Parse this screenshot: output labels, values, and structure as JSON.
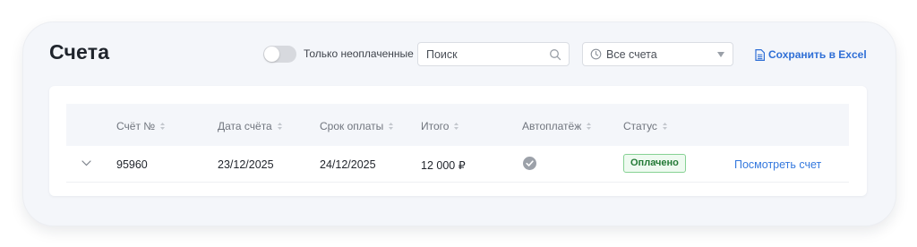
{
  "page": {
    "title": "Счета"
  },
  "toolbar": {
    "unpaid_toggle_label": "Только неоплаченные",
    "unpaid_toggle_on": false,
    "search_placeholder": "Поиск",
    "search_value": "",
    "filter_value": "Все счета",
    "export_label": "Сохранить в Excel"
  },
  "icons": {
    "search": "search-icon",
    "filter": "clock-icon",
    "dropdown": "caret-down-icon",
    "export": "document-icon",
    "sort": "sort-icon",
    "expand": "chevron-down-icon",
    "autopay": "check-circle-icon"
  },
  "table": {
    "columns": [
      "Счёт №",
      "Дата счёта",
      "Срок оплаты",
      "Итого",
      "Автоплатёж",
      "Статус"
    ],
    "rows": [
      {
        "invoice_number": "95960",
        "invoice_date": "23/12/2025",
        "due_date": "24/12/2025",
        "total": "12 000 ₽",
        "autopay": true,
        "status": "Оплачено",
        "action": "Посмотреть счет"
      }
    ]
  },
  "colors": {
    "accent": "#2f6fd6",
    "status_paid_text": "#237a36",
    "status_paid_border": "#86d193",
    "status_paid_bg": "#eefaf0",
    "card_bg": "#f4f6fa"
  }
}
